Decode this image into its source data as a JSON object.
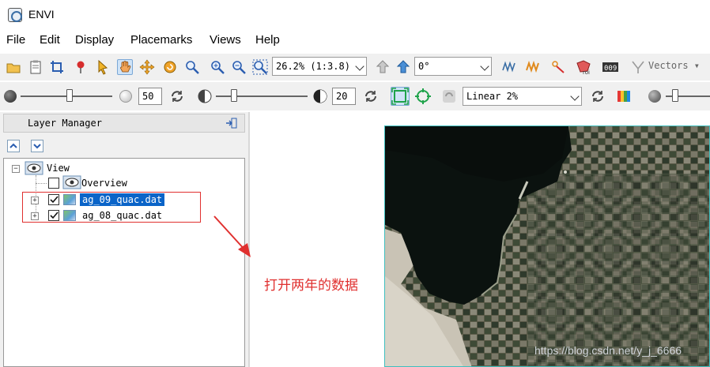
{
  "window": {
    "title": "ENVI"
  },
  "menu": [
    "File",
    "Edit",
    "Display",
    "Placemarks",
    "Views",
    "Help"
  ],
  "toolbar1": {
    "zoom_value": "26.2% (1:3.8)",
    "rotation_value": "0°",
    "vectors_label": "Vectors",
    "icons": [
      "open-folder-icon",
      "data-manager-icon",
      "crop-icon",
      "pin-icon",
      "select-arrow-icon",
      "pan-hand-icon",
      "move-icon",
      "rotate-icon",
      "zoom-icon",
      "zoom-in-icon",
      "zoom-out-icon",
      "zoom-fit-icon",
      "back-icon",
      "forward-icon",
      "spectral-icon",
      "profile-icon",
      "roi-draw-icon",
      "roi-icon",
      "counter-icon",
      "vectors-icon"
    ]
  },
  "toolbar2": {
    "brightness_value": "50",
    "contrast_value": "20",
    "stretch_value": "Linear 2%",
    "brightness_level_pct": 50,
    "contrast_level_pct": 20
  },
  "layer_manager": {
    "title": "Layer Manager",
    "tree": {
      "root": "View",
      "items": [
        {
          "label": "Overview",
          "checked": false
        },
        {
          "label": "ag_09_quac.dat",
          "checked": true,
          "selected": true
        },
        {
          "label": "ag_08_quac.dat",
          "checked": true,
          "selected": false
        }
      ]
    }
  },
  "annotation": {
    "text": "打开两年的数据",
    "color": "#e0302f"
  },
  "watermark": "https://blog.csdn.net/y_j_6666",
  "colors": {
    "selection": "#0a64c8",
    "accent": "#3fbfbf"
  }
}
